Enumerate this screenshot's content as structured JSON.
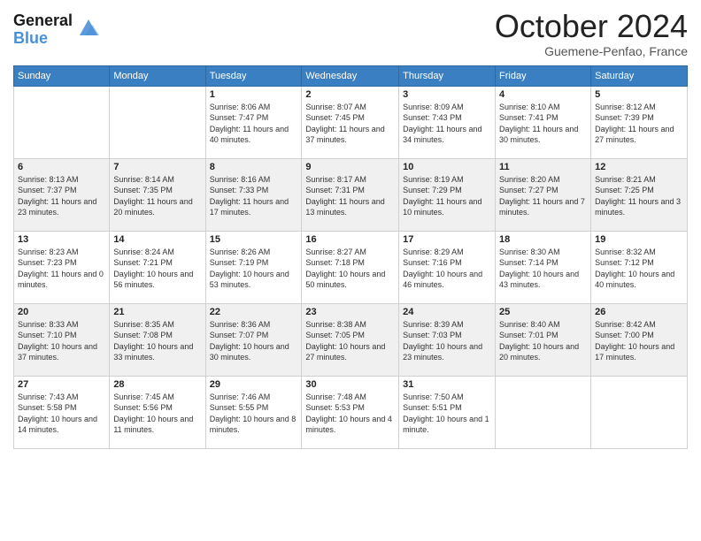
{
  "logo": {
    "line1": "General",
    "line2": "Blue"
  },
  "header": {
    "month": "October 2024",
    "location": "Guemene-Penfao, France"
  },
  "weekdays": [
    "Sunday",
    "Monday",
    "Tuesday",
    "Wednesday",
    "Thursday",
    "Friday",
    "Saturday"
  ],
  "weeks": [
    [
      {
        "day": "",
        "info": ""
      },
      {
        "day": "",
        "info": ""
      },
      {
        "day": "1",
        "info": "Sunrise: 8:06 AM\nSunset: 7:47 PM\nDaylight: 11 hours and 40 minutes."
      },
      {
        "day": "2",
        "info": "Sunrise: 8:07 AM\nSunset: 7:45 PM\nDaylight: 11 hours and 37 minutes."
      },
      {
        "day": "3",
        "info": "Sunrise: 8:09 AM\nSunset: 7:43 PM\nDaylight: 11 hours and 34 minutes."
      },
      {
        "day": "4",
        "info": "Sunrise: 8:10 AM\nSunset: 7:41 PM\nDaylight: 11 hours and 30 minutes."
      },
      {
        "day": "5",
        "info": "Sunrise: 8:12 AM\nSunset: 7:39 PM\nDaylight: 11 hours and 27 minutes."
      }
    ],
    [
      {
        "day": "6",
        "info": "Sunrise: 8:13 AM\nSunset: 7:37 PM\nDaylight: 11 hours and 23 minutes."
      },
      {
        "day": "7",
        "info": "Sunrise: 8:14 AM\nSunset: 7:35 PM\nDaylight: 11 hours and 20 minutes."
      },
      {
        "day": "8",
        "info": "Sunrise: 8:16 AM\nSunset: 7:33 PM\nDaylight: 11 hours and 17 minutes."
      },
      {
        "day": "9",
        "info": "Sunrise: 8:17 AM\nSunset: 7:31 PM\nDaylight: 11 hours and 13 minutes."
      },
      {
        "day": "10",
        "info": "Sunrise: 8:19 AM\nSunset: 7:29 PM\nDaylight: 11 hours and 10 minutes."
      },
      {
        "day": "11",
        "info": "Sunrise: 8:20 AM\nSunset: 7:27 PM\nDaylight: 11 hours and 7 minutes."
      },
      {
        "day": "12",
        "info": "Sunrise: 8:21 AM\nSunset: 7:25 PM\nDaylight: 11 hours and 3 minutes."
      }
    ],
    [
      {
        "day": "13",
        "info": "Sunrise: 8:23 AM\nSunset: 7:23 PM\nDaylight: 11 hours and 0 minutes."
      },
      {
        "day": "14",
        "info": "Sunrise: 8:24 AM\nSunset: 7:21 PM\nDaylight: 10 hours and 56 minutes."
      },
      {
        "day": "15",
        "info": "Sunrise: 8:26 AM\nSunset: 7:19 PM\nDaylight: 10 hours and 53 minutes."
      },
      {
        "day": "16",
        "info": "Sunrise: 8:27 AM\nSunset: 7:18 PM\nDaylight: 10 hours and 50 minutes."
      },
      {
        "day": "17",
        "info": "Sunrise: 8:29 AM\nSunset: 7:16 PM\nDaylight: 10 hours and 46 minutes."
      },
      {
        "day": "18",
        "info": "Sunrise: 8:30 AM\nSunset: 7:14 PM\nDaylight: 10 hours and 43 minutes."
      },
      {
        "day": "19",
        "info": "Sunrise: 8:32 AM\nSunset: 7:12 PM\nDaylight: 10 hours and 40 minutes."
      }
    ],
    [
      {
        "day": "20",
        "info": "Sunrise: 8:33 AM\nSunset: 7:10 PM\nDaylight: 10 hours and 37 minutes."
      },
      {
        "day": "21",
        "info": "Sunrise: 8:35 AM\nSunset: 7:08 PM\nDaylight: 10 hours and 33 minutes."
      },
      {
        "day": "22",
        "info": "Sunrise: 8:36 AM\nSunset: 7:07 PM\nDaylight: 10 hours and 30 minutes."
      },
      {
        "day": "23",
        "info": "Sunrise: 8:38 AM\nSunset: 7:05 PM\nDaylight: 10 hours and 27 minutes."
      },
      {
        "day": "24",
        "info": "Sunrise: 8:39 AM\nSunset: 7:03 PM\nDaylight: 10 hours and 23 minutes."
      },
      {
        "day": "25",
        "info": "Sunrise: 8:40 AM\nSunset: 7:01 PM\nDaylight: 10 hours and 20 minutes."
      },
      {
        "day": "26",
        "info": "Sunrise: 8:42 AM\nSunset: 7:00 PM\nDaylight: 10 hours and 17 minutes."
      }
    ],
    [
      {
        "day": "27",
        "info": "Sunrise: 7:43 AM\nSunset: 5:58 PM\nDaylight: 10 hours and 14 minutes."
      },
      {
        "day": "28",
        "info": "Sunrise: 7:45 AM\nSunset: 5:56 PM\nDaylight: 10 hours and 11 minutes."
      },
      {
        "day": "29",
        "info": "Sunrise: 7:46 AM\nSunset: 5:55 PM\nDaylight: 10 hours and 8 minutes."
      },
      {
        "day": "30",
        "info": "Sunrise: 7:48 AM\nSunset: 5:53 PM\nDaylight: 10 hours and 4 minutes."
      },
      {
        "day": "31",
        "info": "Sunrise: 7:50 AM\nSunset: 5:51 PM\nDaylight: 10 hours and 1 minute."
      },
      {
        "day": "",
        "info": ""
      },
      {
        "day": "",
        "info": ""
      }
    ]
  ]
}
